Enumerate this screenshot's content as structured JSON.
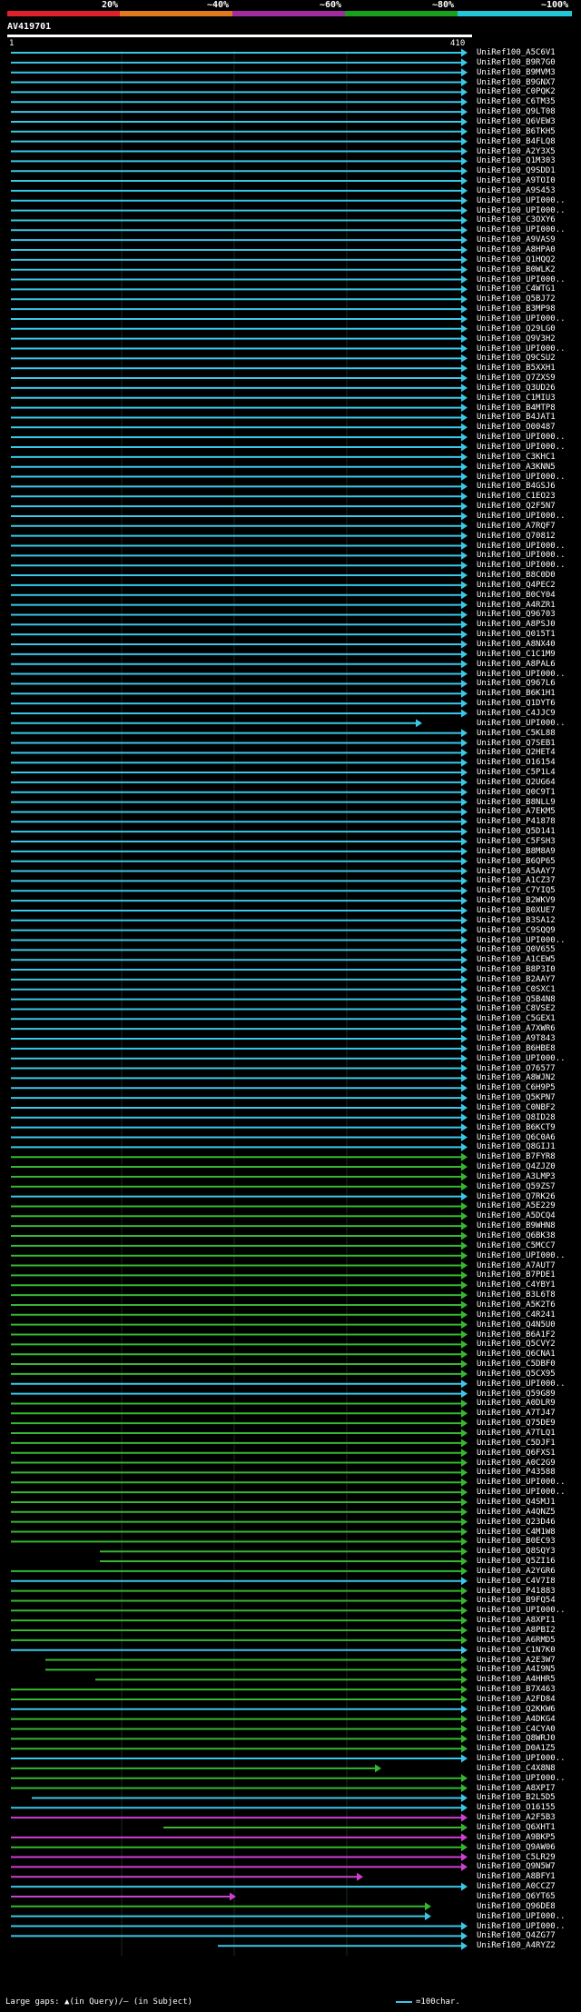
{
  "legend": [
    {
      "label": "20%",
      "color": "#e0202a"
    },
    {
      "label": "~40%",
      "color": "#e07a1c"
    },
    {
      "label": "~60%",
      "color": "#a02ca0"
    },
    {
      "label": "~80%",
      "color": "#1aa01a"
    },
    {
      "label": "~100%",
      "color": "#22c8d8"
    }
  ],
  "query": {
    "title": "AV419701",
    "start": "1",
    "end": "410"
  },
  "colors": {
    "cyan": "#3ac8e8",
    "green": "#35b830",
    "magenta": "#d040d0",
    "gap": "#ffff66"
  },
  "hits": [
    {
      "id": "UniRef100_A5C6V1",
      "c": "cyan"
    },
    {
      "id": "UniRef100_B9R7G0",
      "c": "cyan"
    },
    {
      "id": "UniRef100_B9MVM3",
      "c": "cyan"
    },
    {
      "id": "UniRef100_B9GNX7",
      "c": "cyan"
    },
    {
      "id": "UniRef100_C0PQK2",
      "c": "cyan"
    },
    {
      "id": "UniRef100_C6TM35",
      "c": "cyan"
    },
    {
      "id": "UniRef100_Q9LT08",
      "c": "cyan"
    },
    {
      "id": "UniRef100_Q6VEW3",
      "c": "cyan"
    },
    {
      "id": "UniRef100_B6TKH5",
      "c": "cyan"
    },
    {
      "id": "UniRef100_B4FLQ8",
      "c": "cyan"
    },
    {
      "id": "UniRef100_A2Y3X5",
      "c": "cyan"
    },
    {
      "id": "UniRef100_Q1M303",
      "c": "cyan"
    },
    {
      "id": "UniRef100_Q9SDD1",
      "c": "cyan"
    },
    {
      "id": "UniRef100_A9TOI0",
      "c": "cyan"
    },
    {
      "id": "UniRef100_A9S453",
      "c": "cyan"
    },
    {
      "id": "UniRef100_UPI000..",
      "c": "cyan"
    },
    {
      "id": "UniRef100_UPI000..",
      "c": "cyan"
    },
    {
      "id": "UniRef100_C3OXY6",
      "c": "cyan"
    },
    {
      "id": "UniRef100_UPI000..",
      "c": "cyan"
    },
    {
      "id": "UniRef100_A9VAS9",
      "c": "cyan"
    },
    {
      "id": "UniRef100_A8HPA0",
      "c": "cyan"
    },
    {
      "id": "UniRef100_Q1HQQ2",
      "c": "cyan"
    },
    {
      "id": "UniRef100_B0WLK2",
      "c": "cyan"
    },
    {
      "id": "UniRef100_UPI000..",
      "c": "cyan"
    },
    {
      "id": "UniRef100_C4WTG1",
      "c": "cyan"
    },
    {
      "id": "UniRef100_Q5BJ72",
      "c": "cyan"
    },
    {
      "id": "UniRef100_B3MP98",
      "c": "cyan"
    },
    {
      "id": "UniRef100_UPI000..",
      "c": "cyan"
    },
    {
      "id": "UniRef100_Q29LG0",
      "c": "cyan"
    },
    {
      "id": "UniRef100_Q9V3H2",
      "c": "cyan"
    },
    {
      "id": "UniRef100_UPI000..",
      "c": "cyan"
    },
    {
      "id": "UniRef100_Q9CSU2",
      "c": "cyan"
    },
    {
      "id": "UniRef100_B5XXH1",
      "c": "cyan"
    },
    {
      "id": "UniRef100_Q7ZXS9",
      "c": "cyan"
    },
    {
      "id": "UniRef100_Q3UD26",
      "c": "cyan"
    },
    {
      "id": "UniRef100_C1MIU3",
      "c": "cyan"
    },
    {
      "id": "UniRef100_B4MTP8",
      "c": "cyan"
    },
    {
      "id": "UniRef100_B4JAT1",
      "c": "cyan"
    },
    {
      "id": "UniRef100_O00487",
      "c": "cyan"
    },
    {
      "id": "UniRef100_UPI000..",
      "c": "cyan"
    },
    {
      "id": "UniRef100_UPI000..",
      "c": "cyan"
    },
    {
      "id": "UniRef100_C3KHC1",
      "c": "cyan"
    },
    {
      "id": "UniRef100_A3KNN5",
      "c": "cyan"
    },
    {
      "id": "UniRef100_UPI000..",
      "c": "cyan"
    },
    {
      "id": "UniRef100_B4GSJ6",
      "c": "cyan"
    },
    {
      "id": "UniRef100_C1EO23",
      "c": "cyan"
    },
    {
      "id": "UniRef100_Q2F5N7",
      "c": "cyan"
    },
    {
      "id": "UniRef100_UPI000..",
      "c": "cyan"
    },
    {
      "id": "UniRef100_A7RQF7",
      "c": "cyan"
    },
    {
      "id": "UniRef100_Q70812",
      "c": "cyan"
    },
    {
      "id": "UniRef100_UPI000..",
      "c": "cyan"
    },
    {
      "id": "UniRef100_UPI000..",
      "c": "cyan"
    },
    {
      "id": "UniRef100_UPI000..",
      "c": "cyan"
    },
    {
      "id": "UniRef100_B8C0D0",
      "c": "cyan"
    },
    {
      "id": "UniRef100_Q4PEC2",
      "c": "cyan"
    },
    {
      "id": "UniRef100_B0CY04",
      "c": "cyan"
    },
    {
      "id": "UniRef100_A4RZR1",
      "c": "cyan"
    },
    {
      "id": "UniRef100_Q96703",
      "c": "cyan"
    },
    {
      "id": "UniRef100_A8PSJ0",
      "c": "cyan"
    },
    {
      "id": "UniRef100_Q015T1",
      "c": "cyan"
    },
    {
      "id": "UniRef100_A8NX40",
      "c": "cyan"
    },
    {
      "id": "UniRef100_C1C1M9",
      "c": "cyan"
    },
    {
      "id": "UniRef100_A8PAL6",
      "c": "cyan"
    },
    {
      "id": "UniRef100_UPI000..",
      "c": "cyan"
    },
    {
      "id": "UniRef100_Q967L6",
      "c": "cyan"
    },
    {
      "id": "UniRef100_B6K1H1",
      "c": "cyan"
    },
    {
      "id": "UniRef100_Q1DYT6",
      "c": "cyan"
    },
    {
      "id": "UniRef100_C4JJC9",
      "c": "cyan"
    },
    {
      "id": "UniRef100_UPI000..",
      "c": "cyan"
    },
    {
      "id": "UniRef100_C5KL88",
      "c": "cyan"
    },
    {
      "id": "UniRef100_Q7SEB1",
      "c": "cyan"
    },
    {
      "id": "UniRef100_Q2HET4",
      "c": "cyan"
    },
    {
      "id": "UniRef100_O16154",
      "c": "cyan"
    },
    {
      "id": "UniRef100_C5P1L4",
      "c": "cyan"
    },
    {
      "id": "UniRef100_Q2UG64",
      "c": "cyan"
    },
    {
      "id": "UniRef100_Q0C9T1",
      "c": "cyan"
    },
    {
      "id": "UniRef100_B8NLL9",
      "c": "cyan"
    },
    {
      "id": "UniRef100_A7EKM5",
      "c": "cyan"
    },
    {
      "id": "UniRef100_P41878",
      "c": "cyan"
    },
    {
      "id": "UniRef100_Q5D141",
      "c": "cyan"
    },
    {
      "id": "UniRef100_C5FSH3",
      "c": "cyan"
    },
    {
      "id": "UniRef100_B8M8A9",
      "c": "cyan"
    },
    {
      "id": "UniRef100_B6QP65",
      "c": "cyan"
    },
    {
      "id": "UniRef100_A5AAY7",
      "c": "cyan"
    },
    {
      "id": "UniRef100_A1CZ37",
      "c": "cyan"
    },
    {
      "id": "UniRef100_C7YIQ5",
      "c": "cyan"
    },
    {
      "id": "UniRef100_B2WKV9",
      "c": "cyan"
    },
    {
      "id": "UniRef100_B0XUE7",
      "c": "cyan"
    },
    {
      "id": "UniRef100_B3SA12",
      "c": "cyan"
    },
    {
      "id": "UniRef100_C9SQQ9",
      "c": "cyan"
    },
    {
      "id": "UniRef100_UPI000..",
      "c": "cyan"
    },
    {
      "id": "UniRef100_Q0V655",
      "c": "cyan"
    },
    {
      "id": "UniRef100_A1CEW5",
      "c": "cyan"
    },
    {
      "id": "UniRef100_B8P3I0",
      "c": "cyan"
    },
    {
      "id": "UniRef100_B2AAY7",
      "c": "cyan"
    },
    {
      "id": "UniRef100_C0SXC1",
      "c": "cyan"
    },
    {
      "id": "UniRef100_Q5B4N8",
      "c": "cyan"
    },
    {
      "id": "UniRef100_C8VSE2",
      "c": "cyan"
    },
    {
      "id": "UniRef100_C5GEX1",
      "c": "cyan"
    },
    {
      "id": "UniRef100_A7XWR6",
      "c": "cyan"
    },
    {
      "id": "UniRef100_A9T843",
      "c": "cyan"
    },
    {
      "id": "UniRef100_B6HBE8",
      "c": "cyan"
    },
    {
      "id": "UniRef100_UPI000..",
      "c": "cyan"
    },
    {
      "id": "UniRef100_O76577",
      "c": "cyan"
    },
    {
      "id": "UniRef100_A8WJN2",
      "c": "cyan"
    },
    {
      "id": "UniRef100_C6H9P5",
      "c": "cyan"
    },
    {
      "id": "UniRef100_Q5KPN7",
      "c": "cyan"
    },
    {
      "id": "UniRef100_C0NBF2",
      "c": "cyan"
    },
    {
      "id": "UniRef100_Q8ID28",
      "c": "cyan"
    },
    {
      "id": "UniRef100_B6KCT9",
      "c": "cyan"
    },
    {
      "id": "UniRef100_Q6C0A6",
      "c": "cyan"
    },
    {
      "id": "UniRef100_Q8GIJ1",
      "c": "cyan"
    },
    {
      "id": "UniRef100_B7FYR8",
      "c": "green"
    },
    {
      "id": "UniRef100_Q4ZJZ0",
      "c": "green"
    },
    {
      "id": "UniRef100_A3LMP3",
      "c": "green"
    },
    {
      "id": "UniRef100_Q59ZS7",
      "c": "green"
    },
    {
      "id": "UniRef100_Q7RK26",
      "c": "cyan"
    },
    {
      "id": "UniRef100_A5E229",
      "c": "green"
    },
    {
      "id": "UniRef100_A5DCQ4",
      "c": "green"
    },
    {
      "id": "UniRef100_B9WHN8",
      "c": "green"
    },
    {
      "id": "UniRef100_Q6BK38",
      "c": "green"
    },
    {
      "id": "UniRef100_C5MCC7",
      "c": "green"
    },
    {
      "id": "UniRef100_UPI000..",
      "c": "green"
    },
    {
      "id": "UniRef100_A7AUT7",
      "c": "green"
    },
    {
      "id": "UniRef100_B7PDE1",
      "c": "green"
    },
    {
      "id": "UniRef100_C4YBY1",
      "c": "green"
    },
    {
      "id": "UniRef100_B3L6T8",
      "c": "green"
    },
    {
      "id": "UniRef100_A5K2T6",
      "c": "green"
    },
    {
      "id": "UniRef100_C4R241",
      "c": "green"
    },
    {
      "id": "UniRef100_Q4N5U0",
      "c": "green"
    },
    {
      "id": "UniRef100_B6A1F2",
      "c": "green"
    },
    {
      "id": "UniRef100_Q5CVY2",
      "c": "green"
    },
    {
      "id": "UniRef100_Q6CNA1",
      "c": "green"
    },
    {
      "id": "UniRef100_C5DBF0",
      "c": "green"
    },
    {
      "id": "UniRef100_Q5CX95",
      "c": "green"
    },
    {
      "id": "UniRef100_UPI000..",
      "c": "cyan"
    },
    {
      "id": "UniRef100_Q59G89",
      "c": "cyan"
    },
    {
      "id": "UniRef100_A0DLR9",
      "c": "green"
    },
    {
      "id": "UniRef100_A7TJ47",
      "c": "green"
    },
    {
      "id": "UniRef100_Q75DE9",
      "c": "green"
    },
    {
      "id": "UniRef100_A7TLQ1",
      "c": "green"
    },
    {
      "id": "UniRef100_C5DJF1",
      "c": "green"
    },
    {
      "id": "UniRef100_Q6FXS1",
      "c": "green"
    },
    {
      "id": "UniRef100_A0C2G9",
      "c": "green"
    },
    {
      "id": "UniRef100_P43588",
      "c": "green"
    },
    {
      "id": "UniRef100_UPI000..",
      "c": "green"
    },
    {
      "id": "UniRef100_UPI000..",
      "c": "green"
    },
    {
      "id": "UniRef100_Q4SMJ1",
      "c": "green"
    },
    {
      "id": "UniRef100_A4QNZ5",
      "c": "green"
    },
    {
      "id": "UniRef100_Q23D46",
      "c": "green"
    },
    {
      "id": "UniRef100_C4M1W8",
      "c": "green"
    },
    {
      "id": "UniRef100_B0EC93",
      "c": "green"
    },
    {
      "id": "UniRef100_Q8SQY3",
      "c": "green"
    },
    {
      "id": "UniRef100_Q5ZI16",
      "c": "green"
    },
    {
      "id": "UniRef100_A2YGR6",
      "c": "green"
    },
    {
      "id": "UniRef100_C4V7I8",
      "c": "cyan"
    },
    {
      "id": "UniRef100_P41883",
      "c": "green"
    },
    {
      "id": "UniRef100_B9FQ54",
      "c": "green"
    },
    {
      "id": "UniRef100_UPI000..",
      "c": "green"
    },
    {
      "id": "UniRef100_A8XPI1",
      "c": "green"
    },
    {
      "id": "UniRef100_A8PBI2",
      "c": "green"
    },
    {
      "id": "UniRef100_A6RMD5",
      "c": "green"
    },
    {
      "id": "UniRef100_C1N7K0",
      "c": "cyan"
    },
    {
      "id": "UniRef100_A2E3W7",
      "c": "green"
    },
    {
      "id": "UniRef100_A4I9N5",
      "c": "green"
    },
    {
      "id": "UniRef100_A4HHR5",
      "c": "green"
    },
    {
      "id": "UniRef100_B7X463",
      "c": "green"
    },
    {
      "id": "UniRef100_A2FD84",
      "c": "green"
    },
    {
      "id": "UniRef100_Q2KKW6",
      "c": "cyan"
    },
    {
      "id": "UniRef100_A4DKG4",
      "c": "green"
    },
    {
      "id": "UniRef100_C4CYA0",
      "c": "green"
    },
    {
      "id": "UniRef100_Q8WRJ0",
      "c": "green"
    },
    {
      "id": "UniRef100_D0A1Z5",
      "c": "green"
    },
    {
      "id": "UniRef100_UPI000..",
      "c": "cyan"
    },
    {
      "id": "UniRef100_C4X8N8",
      "c": "green"
    },
    {
      "id": "UniRef100_UPI000..",
      "c": "green"
    },
    {
      "id": "UniRef100_A8XPI7",
      "c": "green"
    },
    {
      "id": "UniRef100_B2L5D5",
      "c": "cyan"
    },
    {
      "id": "UniRef100_O16155",
      "c": "cyan"
    },
    {
      "id": "UniRef100_A2F5B3",
      "c": "magenta"
    },
    {
      "id": "UniRef100_Q6XHT1",
      "c": "green"
    },
    {
      "id": "UniRef100_A9BKP5",
      "c": "magenta"
    },
    {
      "id": "UniRef100_Q9AW06",
      "c": "green"
    },
    {
      "id": "UniRef100_C5LR29",
      "c": "magenta"
    },
    {
      "id": "UniRef100_Q9N5W7",
      "c": "magenta"
    },
    {
      "id": "UniRef100_A8BFY1",
      "c": "magenta"
    },
    {
      "id": "UniRef100_A0CCZ7",
      "c": "cyan"
    },
    {
      "id": "UniRef100_Q6YT65",
      "c": "magenta"
    },
    {
      "id": "UniRef100_Q96DE8",
      "c": "green"
    },
    {
      "id": "UniRef100_UPI000..",
      "c": "cyan"
    },
    {
      "id": "UniRef100_UPI000..",
      "c": "cyan"
    },
    {
      "id": "UniRef100_Q4ZG77",
      "c": "cyan"
    },
    {
      "id": "UniRef100_A4RYZ2",
      "c": "cyan"
    }
  ],
  "footer": {
    "gaps_text": "Large gaps: ▲(in Query)/– (in Subject)",
    "scale_text": "=100char."
  }
}
